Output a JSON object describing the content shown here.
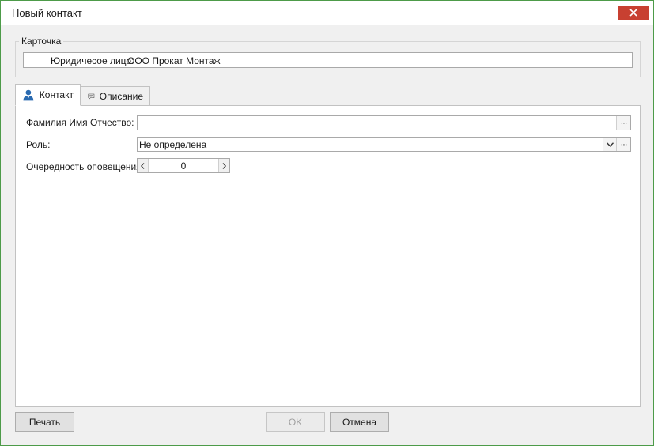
{
  "window": {
    "title": "Новый контакт"
  },
  "card_group": {
    "legend": "Карточка",
    "field_label": "Юридичесое лицо:",
    "field_value": "ООО Прокат Монтаж"
  },
  "tabs": [
    {
      "label": "Контакт",
      "icon": "user-icon",
      "active": true
    },
    {
      "label": "Описание",
      "icon": "comment-icon",
      "active": false
    }
  ],
  "form": {
    "fio_label": "Фамилия Имя Отчество:",
    "fio_value": "",
    "role_label": "Роль:",
    "role_value": "Не определена",
    "order_label": "Очередность оповещения:",
    "order_value": "0"
  },
  "buttons": {
    "print": "Печать",
    "ok": "OK",
    "cancel": "Отмена"
  },
  "colors": {
    "close_button": "#c84031",
    "window_border": "#4d9b49",
    "tab_icon": "#2a6ab0"
  }
}
